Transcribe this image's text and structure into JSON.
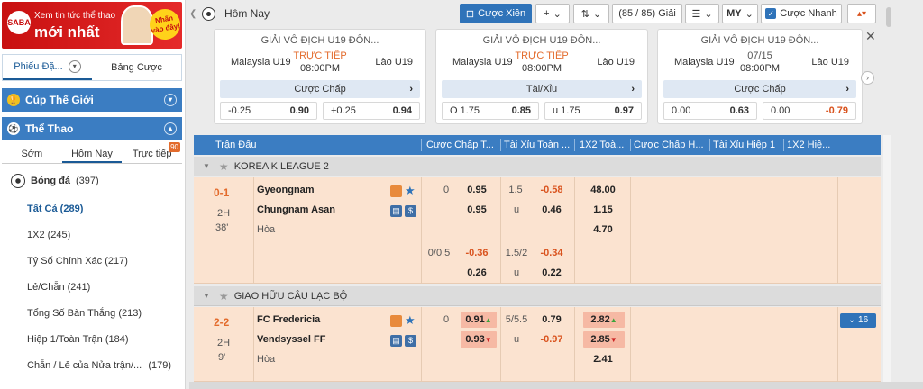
{
  "banner": {
    "logo": "SABA",
    "line1": "Xem tin tức thể thao",
    "line2": "mới nhất",
    "badge": "Nhấn vào đây!"
  },
  "sidebar": {
    "tabs": [
      {
        "label": "Phiếu Đặ..."
      },
      {
        "label": "Bảng Cược"
      }
    ],
    "world_cup": "Cúp Thế Giới",
    "sports": "Thể Thao",
    "sub_tabs": [
      {
        "label": "Sớm"
      },
      {
        "label": "Hôm Nay"
      },
      {
        "label": "Trực tiếp"
      }
    ],
    "live_count": "90",
    "sport": {
      "name": "Bóng đá",
      "count": "(397)"
    },
    "menu": [
      {
        "label": "Tất Cả (289)"
      },
      {
        "label": "1X2 (245)"
      },
      {
        "label": "Tỷ Số Chính Xác (217)"
      },
      {
        "label": "Lẻ/Chẵn (241)"
      },
      {
        "label": "Tổng Số Bàn Thắng (213)"
      },
      {
        "label": "Hiệp 1/Toàn Trận (184)"
      },
      {
        "label": "Chẵn / Lẻ của Nửa trận/...",
        "count": "(179)"
      }
    ]
  },
  "topbar": {
    "title": "Hôm Nay",
    "parlay": "Cược Xiên",
    "plus": "+",
    "games": "(85 / 85) Giải",
    "odds_type": "MY",
    "quick_bet": "Cược Nhanh"
  },
  "cards": [
    {
      "league": "GIẢI VÔ ĐỊCH U19 ĐÔN...",
      "home": "Malaysia U19",
      "away": "Lào U19",
      "status": "TRỰC TIẾP",
      "time": "08:00PM",
      "bet_type": "Cược Chấp",
      "o1_label": "-0.25",
      "o1_val": "0.90",
      "o2_label": "+0.25",
      "o2_val": "0.94"
    },
    {
      "league": "GIẢI VÔ ĐỊCH U19 ĐÔN...",
      "home": "Malaysia U19",
      "away": "Lào U19",
      "status": "TRỰC TIẾP",
      "time": "08:00PM",
      "bet_type": "Tài/Xỉu",
      "o1_label": "O 1.75",
      "o1_val": "0.85",
      "o2_label": "u 1.75",
      "o2_val": "0.97"
    },
    {
      "league": "GIẢI VÔ ĐỊCH U19 ĐÔN...",
      "home": "Malaysia U19",
      "away": "Lào U19",
      "status": "07/15",
      "time": "08:00PM",
      "bet_type": "Cược Chấp",
      "o1_label": "0.00",
      "o1_val": "0.63",
      "o2_label": "0.00",
      "o2_val": "-0.79"
    }
  ],
  "table": {
    "headers": [
      "Trận Đấu",
      "Cược Chấp T...",
      "Tài Xỉu Toàn ...",
      "1X2 Toà...",
      "Cược Chấp H...",
      "Tài Xỉu Hiệp 1",
      "1X2 Hiệ..."
    ]
  },
  "leagues": [
    {
      "name": "KOREA K LEAGUE 2",
      "match": {
        "score": "0-1",
        "half": "2H",
        "minute": "38'",
        "home": "Gyeongnam",
        "away": "Chungnam Asan",
        "draw": "Hòa",
        "hdp": {
          "line": "0",
          "home": "0.95",
          "away": "0.95"
        },
        "ou": {
          "line": "1.5",
          "over": "-0.58",
          "under_label": "u",
          "under": "0.46"
        },
        "x12": {
          "home": "48.00",
          "away": "1.15",
          "draw": "4.70"
        },
        "hdp2": {
          "line": "0/0.5",
          "home": "-0.36",
          "away": "0.26"
        },
        "ou2": {
          "line": "1.5/2",
          "over": "-0.34",
          "under_label": "u",
          "under": "0.22"
        }
      }
    },
    {
      "name": "GIAO HỮU CÂU LẠC BỘ",
      "match": {
        "score": "2-2",
        "half": "2H",
        "minute": "9'",
        "home": "FC Fredericia",
        "away": "Vendsyssel FF",
        "draw": "Hòa",
        "hdp": {
          "line": "0",
          "home": "0.91",
          "away": "0.93"
        },
        "ou": {
          "line": "5/5.5",
          "over": "0.79",
          "under_label": "u",
          "under": "-0.97"
        },
        "x12": {
          "home": "2.82",
          "away": "2.85",
          "draw": "2.41"
        },
        "more": "16"
      }
    }
  ]
}
